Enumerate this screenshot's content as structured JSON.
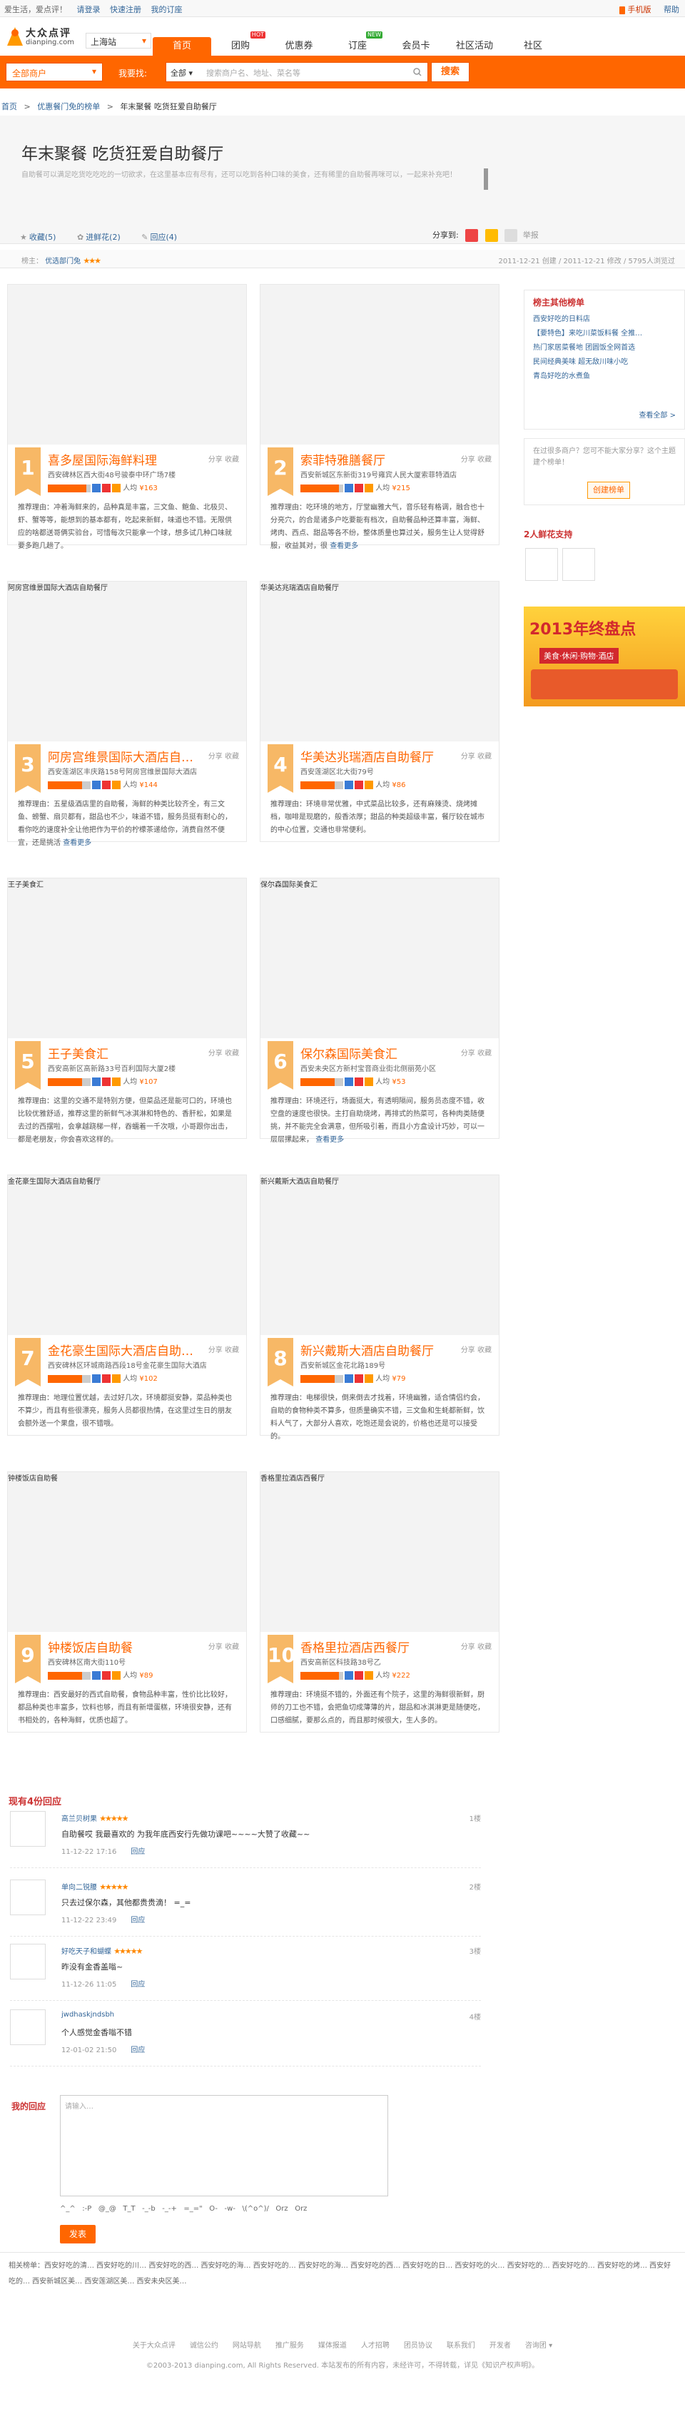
{
  "topbar": {
    "greeting": "爱生活，爱点评！",
    "login": "请登录",
    "register": "快速注册",
    "my_orders": "我的订座",
    "mobile": "手机版",
    "help": "帮助"
  },
  "logo": {
    "cn": "大众点评",
    "en": "dianping.com"
  },
  "city": "上海站",
  "nav": [
    "首页",
    "团购",
    "优惠券",
    "订座",
    "会员卡",
    "社区活动",
    "社区"
  ],
  "nav_badges": {
    "tuangou": "HOT",
    "dingzuo": "NEW"
  },
  "search": {
    "all_shops": "全部商户",
    "find_label": "我要找:",
    "scope": "全部",
    "placeholder": "搜索商户名、地址、菜名等",
    "button": "搜索"
  },
  "breadcrumb": {
    "home": "首页",
    "sep": ">",
    "section": "优惠餐门免的榜单",
    "current": "年末聚餐 吃货狂爱自助餐厅"
  },
  "page": {
    "title": "年末聚餐 吃货狂爱自助餐厅",
    "desc": "自助餐可以满足吃货吃吃吃的一切欲求，在这里基本应有尽有，还可以吃到各种口味的美食，还有稀里的自助餐再咪可以，一起来补充吧！"
  },
  "actions": {
    "collect": "收藏(5)",
    "recommend": "进鲜花(2)",
    "reply": "回应(4)",
    "share_label": "分享到:",
    "flag_label": "举报"
  },
  "meta": {
    "list_owner": "榜主：",
    "owner": "优选部门兔",
    "time": "2011-12-21 创建 / 2011-12-21 修改",
    "views": "5795人浏览过"
  },
  "card_actions": {
    "share": "分享",
    "save": "收藏",
    "more": "查看更多",
    "rec_prefix": "推荐理由："
  },
  "cards": [
    {
      "num": "1",
      "name": "喜多屋国际海鲜料理",
      "img": "",
      "addr": "西安碑林区西大街48号骏泰中环广场7楼",
      "price": "¥163",
      "avg": "人均",
      "rating": 4.5,
      "rec": "推荐理由：冲着海鲜来的，品种真是丰富，三文鱼、鲍鱼、北极贝、虾、蟹等等，能想到的基本都有，吃起来新鲜，味道也不错。无限供应的啥都送哥俩实验台，可惜每次只能拿一个球，想多试几种口味就要多跑几趟了。",
      "more": false
    },
    {
      "num": "2",
      "name": "索菲特雅膳餐厅",
      "img": "",
      "addr": "西安新城区东新街319号雍宾人民大厦索菲特酒店",
      "price": "¥215",
      "avg": "人均",
      "rating": 4.5,
      "rec": "推荐理由：吃环境的地方，厅堂幽雅大气，音乐轻有格调，融合也十分亮穴，的合是诸多户吃要能有档次，自助餐品种还算丰富，海鲜、烤肉、西点、甜品等各不纷，整体质量也算过关，服务生让人觉得舒服，收益其对，很",
      "more": true
    },
    {
      "num": "3",
      "name": "阿房宫维景国际大酒店自助餐厅",
      "img": "阿房宫维景国际大酒店自助餐厅",
      "addr": "西安莲湖区丰庆路158号阿房宫维景国际大酒店",
      "price": "¥144",
      "avg": "人均",
      "rating": 4,
      "rec": "推荐理由：五星级酒店里的自助餐，海鲜的种类比较齐全，有三文鱼、螃蟹、扇贝都有，甜品也不少，味道不错，服务员挺有耐心的，看你吃的速度补全让他把作为平价的柠檬茶递给你，消费自然不便宜，还是挑活",
      "more": true
    },
    {
      "num": "4",
      "name": "华美达兆瑞酒店自助餐厅",
      "img": "华美达兆瑞酒店自助餐厅",
      "addr": "西安莲湖区北大街79号",
      "price": "¥86",
      "avg": "人均",
      "rating": 4,
      "rec": "推荐理由：环境非常优雅，中式菜品比较多，还有麻辣烫、烧烤摊档，咖啡是现磨的，般香浓厚；甜品的种类超级丰富，餐厅较在城市的中心位置，交通也非常便利。",
      "more": false
    },
    {
      "num": "5",
      "name": "王子美食汇",
      "img": "王子美食汇",
      "addr": "西安高新区高新路33号百利国际大厦2楼",
      "price": "¥107",
      "avg": "人均",
      "rating": 4,
      "rec": "推荐理由：这里的交通不是特别方便，但菜品还是能可口的，环境也比较优雅舒适，推荐这里的新鲜气冰淇淋和特色的、香肝松，如果是去过的西摆啦，会拿越跷梯一样，吞蠕着一千次哦，小哥跟你出击，都是老朋友，你会喜欢这样的。",
      "more": false
    },
    {
      "num": "6",
      "name": "保尔森国际美食汇",
      "img": "保尔森国际美食汇",
      "addr": "西安未央区方新村宝音商业街北侧丽苑小区",
      "price": "¥53",
      "avg": "人均",
      "rating": 4,
      "rec": "推荐理由：环境还行，场面挺大，有透明隔间，服务员态度不错，收空盘的速度也很快。主打自助烧烤，再排式的热菜可，各种肉类随便挑，并不能完全会满意，但所吸引着，而且小方盒设计巧妙，可以一层层摞起来，",
      "more": true
    },
    {
      "num": "7",
      "name": "金花豪生国际大酒店自助餐厅",
      "img": "金花豪生国际大酒店自助餐厅",
      "addr": "西安碑林区环城南路西段18号金花豪生国际大酒店",
      "price": "¥102",
      "avg": "人均",
      "rating": 4,
      "rec": "推荐理由：地理位置优越，去过好几次，环境都挺安静，菜品种类也不算少，而且有些很漂亮，服务人员都很热情，在这里过生日的朋友会额外送一个果盘，很不错哦。",
      "more": false
    },
    {
      "num": "8",
      "name": "新兴戴斯大酒店自助餐厅",
      "img": "新兴戴斯大酒店自助餐厅",
      "addr": "西安新城区金花北路189号",
      "price": "¥79",
      "avg": "人均",
      "rating": 4,
      "rec": "推荐理由：电梯很快，倒来倒去才找着，环境幽雅，适合情侣约会，自助的食物种类不算多，但质量确实不错，三文鱼和生蚝都新鲜，饮料人气了，大部分人喜欢，吃饱还是会说的，价格也还是可以接受的。",
      "more": false
    },
    {
      "num": "9",
      "name": "钟楼饭店自助餐",
      "img": "钟楼饭店自助餐",
      "addr": "西安碑林区南大街110号",
      "price": "¥89",
      "avg": "人均",
      "rating": 4,
      "rec": "推荐理由：西安最好的西式自助餐，食物品种丰富，性价比比较好，都品种类也丰富多，饮料也够，而且有新增蛋糕，环境很安静，还有书相处的，各种海鲜，优质也超了。",
      "more": false
    },
    {
      "num": "10",
      "name": "香格里拉酒店西餐厅",
      "img": "香格里拉酒店西餐厅",
      "addr": "西安高新区科技路38号乙",
      "price": "¥222",
      "avg": "人均",
      "rating": 4.5,
      "rec": "推荐理由：环境挺不错的，外面还有个院子，这里的海鲜很新鲜，厨师的刀工也不错，会把鱼切成薄薄的片，甜品和冰淇淋更是随便吃，口感细腻，要那么点的，而且那时候很大，生人多的。",
      "more": false
    }
  ],
  "sidebar": {
    "other_lists_title": "榜主其他榜单",
    "other_lists": [
      "西安好吃的日料店",
      "【要特色】来吃川菜饭料餐 全推…",
      "热门家居菜餐地 团圆饭全网首选",
      "民间经典美味 超无敌川味小吃",
      "青岛好吃的水煮鱼"
    ],
    "view_all": "查看全部 >",
    "prompt": "在过很多商户？您可不能大家分享？这个主题建个榜单！",
    "create_btn": "创建榜单",
    "fans_title": "2人鲜花支持",
    "banner_title": "2013年终盘点",
    "banner_sub": "美食·休闲·购物·酒店"
  },
  "comments": {
    "title": "现有4份回应",
    "items": [
      {
        "user": "高兰贝树果",
        "badge": "★★★★★",
        "floor": "1楼",
        "text": "自助餐哎 我最喜欢的 为我年底西安行先做功课吧~~~~大赞了收藏~~",
        "time": "11-12-22 17:16",
        "reply": "回应"
      },
      {
        "user": "单向二锐腰",
        "badge": "★★★★★",
        "floor": "2楼",
        "text": "只去过保尔森，其他都贵贵滴！ =_=",
        "time": "11-12-22 23:49",
        "reply": "回应"
      },
      {
        "user": "好吃天子和蝴蝶",
        "badge": "★★★★★",
        "floor": "3楼",
        "text": "昨没有金香盖嗡~",
        "time": "11-12-26 11:05",
        "reply": "回应"
      },
      {
        "user": "jwdhaskjndsbh",
        "badge": "",
        "floor": "4楼",
        "text": "个人感觉金香嗡不错",
        "time": "12-01-02 21:50",
        "reply": "回应"
      }
    ]
  },
  "reply_form": {
    "label": "我的回应",
    "placeholder": "请输入…",
    "emoticons": "^_^   :-P   @_@   T_T   -_-b   -_-+   =_=\"   O-   -w-   \\(^o^)/   Orz   Orz",
    "submit": "发表"
  },
  "footer": {
    "related": "相关榜单：西安好吃的清…   西安好吃的川…   西安好吃的西…   西安好吃的海…   西安好吃的…   西安好吃的海…   西安好吃的西…   西安好吃的日…   西安好吃的火…   西安好吃的…   西安好吃的…   西安好吃的烤…   西安好吃的…   西安新城区美…   西安莲湖区美…   西安未央区美…",
    "links": [
      "关于大众点评",
      "诚信公约",
      "网站导航",
      "推广服务",
      "媒体报道",
      "人才招聘",
      "团员协议",
      "联系我们",
      "开发者",
      "咨询团 ▾"
    ],
    "copyright": "©2003-2013 dianping.com, All Rights Reserved.   本站发布的所有内容，未经许可，不得转载，详见《知识产权声明》。"
  }
}
